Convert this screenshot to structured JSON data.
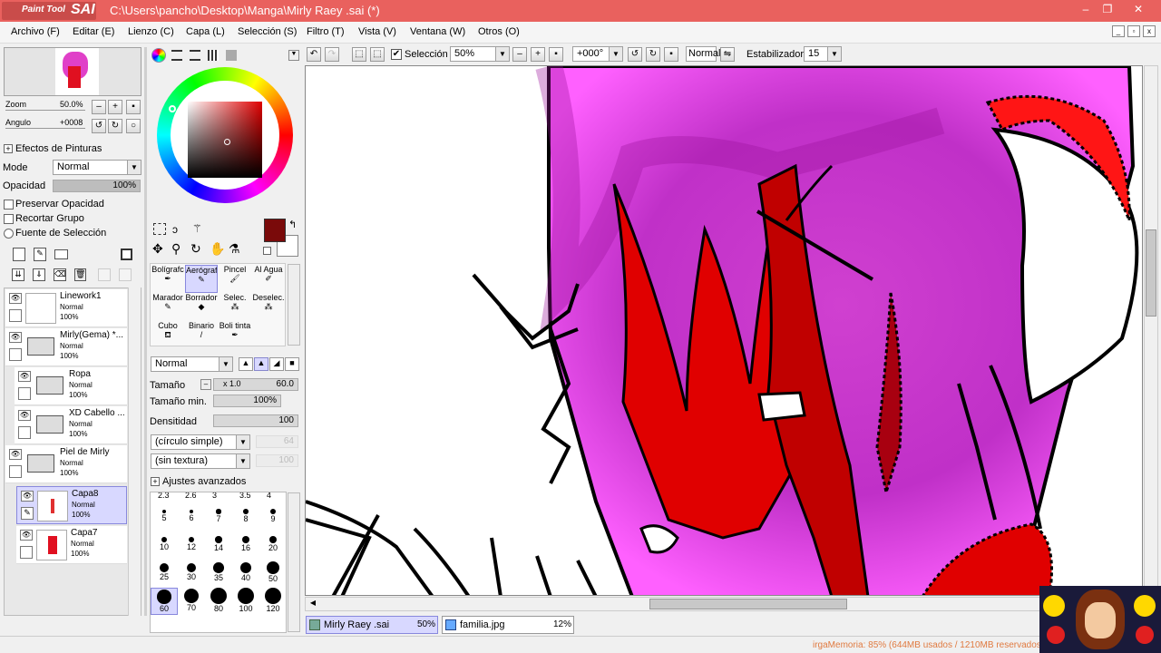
{
  "app": {
    "logo_small": "Paint Tool",
    "logo_big": "SAI",
    "title": "C:\\Users\\pancho\\Desktop\\Manga\\Mirly Raey .sai (*)"
  },
  "window_controls": {
    "minimize": "–",
    "maximize": "❐",
    "close": "✕"
  },
  "menu": [
    "Archivo (F)",
    "Editar (E)",
    "Lienzo (C)",
    "Capa (L)",
    "Selección (S)",
    "Filtro (T)",
    "Vista (V)",
    "Ventana (W)",
    "Otros (O)"
  ],
  "navigator": {
    "zoom_label": "Zoom",
    "zoom_value": "50.0%",
    "angle_label": "Angulo",
    "angle_value": "+0008"
  },
  "layer_props": {
    "effects_label": "Efectos de Pinturas",
    "mode_label": "Mode",
    "mode_value": "Normal",
    "opacity_label": "Opacidad",
    "opacity_value": "100%",
    "opacity_level": 1.0,
    "preserve_opacity": "Preservar Opacidad",
    "clip_group": "Recortar Grupo",
    "selection_source": "Fuente de Selección"
  },
  "layers": [
    {
      "name": "Linework1",
      "mode": "Normal",
      "opacity": "100%",
      "type": "layer",
      "selected": false,
      "indent": false
    },
    {
      "name": "Mirly(Gema) *...",
      "mode": "Normal",
      "opacity": "100%",
      "type": "folder",
      "selected": false,
      "indent": false
    },
    {
      "name": "Ropa",
      "mode": "Normal",
      "opacity": "100%",
      "type": "folder",
      "selected": false,
      "indent": true
    },
    {
      "name": "XD Cabello ...",
      "mode": "Normal",
      "opacity": "100%",
      "type": "folder",
      "selected": false,
      "indent": true
    },
    {
      "name": "Piel de Mirly",
      "mode": "Normal",
      "opacity": "100%",
      "type": "folder",
      "selected": false,
      "indent": false
    },
    {
      "name": "Capa8",
      "mode": "Normal",
      "opacity": "100%",
      "type": "layer",
      "selected": true,
      "indent": true
    },
    {
      "name": "Capa7",
      "mode": "Normal",
      "opacity": "100%",
      "type": "layer",
      "selected": false,
      "indent": true
    }
  ],
  "colors": {
    "primary": "#7a0a0a",
    "secondary": "#ffffff",
    "accent_title": "#e9615e",
    "selection_bg": "#d8d8ff"
  },
  "tools": [
    {
      "label": "Bolígrafc",
      "icon": "pen-icon"
    },
    {
      "label": "Aerógraf",
      "icon": "airbrush-icon"
    },
    {
      "label": "Pincel",
      "icon": "brush-icon"
    },
    {
      "label": "Al Agua",
      "icon": "watercolor-icon"
    },
    {
      "label": "Marador",
      "icon": "marker-icon"
    },
    {
      "label": "Borrador",
      "icon": "eraser-icon"
    },
    {
      "label": "Selec.",
      "icon": "select-pen-icon"
    },
    {
      "label": "Deselec.",
      "icon": "deselect-pen-icon"
    },
    {
      "label": "Cubo",
      "icon": "bucket-icon"
    },
    {
      "label": "Binario",
      "icon": "binary-pen-icon"
    },
    {
      "label": "Boli tinta",
      "icon": "ink-pen-icon"
    }
  ],
  "brush": {
    "blend_mode": "Normal",
    "size_label": "Tamaño",
    "size_mult": "x 1.0",
    "size_value": "60.0",
    "min_size_label": "Tamaño min.",
    "min_size_value": "100%",
    "density_label": "Densitidad",
    "density_value": "100",
    "shape": "(círculo simple)",
    "shape_value": "64",
    "texture": "(sin textura)",
    "texture_value": "100",
    "advanced_label": "Ajustes avanzados"
  },
  "brush_sizes_top_partial": [
    "2.3",
    "2.6",
    "3",
    "3.5",
    "4"
  ],
  "brush_sizes": [
    "5",
    "6",
    "7",
    "8",
    "9",
    "10",
    "12",
    "14",
    "16",
    "20",
    "25",
    "30",
    "35",
    "40",
    "50",
    "60",
    "70",
    "80",
    "100",
    "120"
  ],
  "brush_size_selected": "60",
  "toolbar": {
    "selection_label": "Selección",
    "zoom_value": "50%",
    "rotation_value": "+000°",
    "blend_value": "Normal",
    "stabilizer_label": "Estabilizador",
    "stabilizer_value": "15"
  },
  "tabs": [
    {
      "name": "Mirly Raey .sai",
      "zoom": "50%",
      "active": true
    },
    {
      "name": "familia.jpg",
      "zoom": "12%",
      "active": false
    }
  ],
  "status": {
    "memory": "irgaMemoria: 85% (644MB usados / 1210MB reservados)"
  }
}
